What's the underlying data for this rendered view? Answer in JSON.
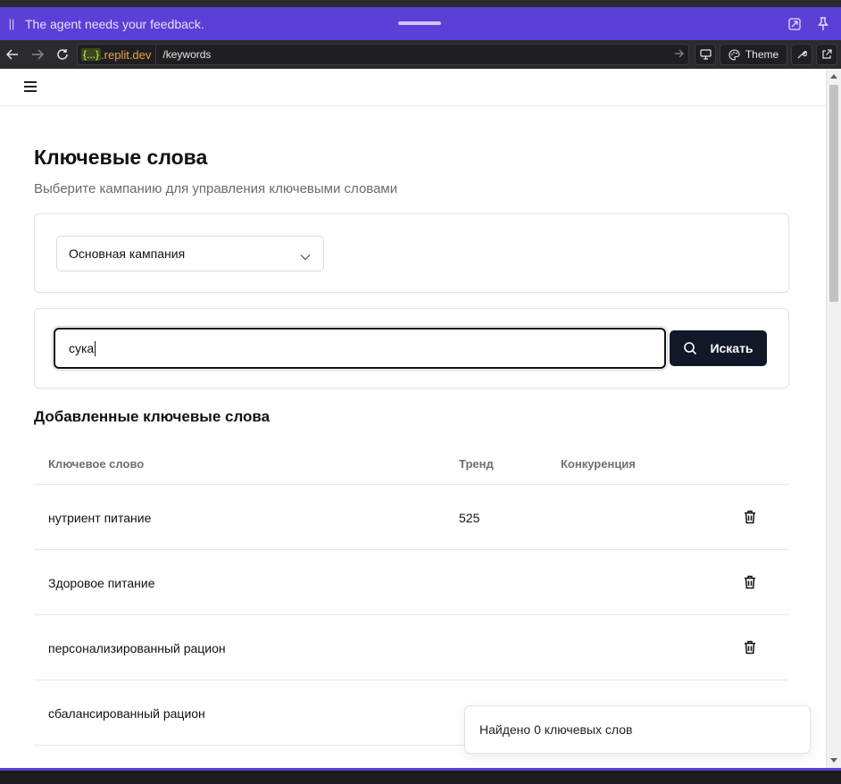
{
  "agent_bar": {
    "message": "The agent needs your feedback."
  },
  "browser": {
    "host_tag": "{...}",
    "host_domain": ".replit.dev",
    "path": "/keywords",
    "theme_label": "Theme"
  },
  "page": {
    "title": "Ключевые слова",
    "subtitle": "Выберите кампанию для управления ключевыми словами"
  },
  "campaign_select": {
    "value": "Основная кампания"
  },
  "search": {
    "value": "сука",
    "button_label": "Искать"
  },
  "keywords_section": {
    "title": "Добавленные ключевые слова",
    "columns": [
      "Ключевое слово",
      "Тренд",
      "Конкуренция"
    ],
    "rows": [
      {
        "keyword": "нутриент питание",
        "trend": "525",
        "competition": ""
      },
      {
        "keyword": "Здоровое питание",
        "trend": "",
        "competition": ""
      },
      {
        "keyword": "персонализированный рацион",
        "trend": "",
        "competition": ""
      },
      {
        "keyword": "сбалансированный рацион",
        "trend": "",
        "competition": ""
      }
    ]
  },
  "toast": {
    "message": "Найдено 0 ключевых слов"
  },
  "colors": {
    "agent_bar": "#5b3fd6",
    "primary_button": "#111827",
    "domain": "#f0a33b"
  },
  "icons": [
    "pause-icon",
    "drag-handle",
    "popout-icon",
    "pin-icon",
    "back-icon",
    "forward-icon",
    "reload-icon",
    "arrow-right-icon",
    "devices-icon",
    "palette-icon",
    "wrench-icon",
    "external-link-icon",
    "menu-icon",
    "chevron-down-icon",
    "search-icon",
    "trash-icon"
  ]
}
